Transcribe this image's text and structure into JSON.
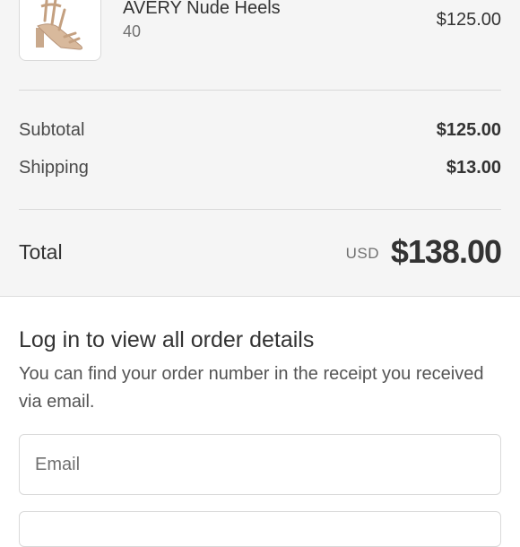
{
  "order_summary": {
    "item": {
      "name": "AVERY Nude Heels",
      "variant": "40",
      "price": "$125.00",
      "image_icon": "heel-sandal-image"
    },
    "subtotal": {
      "label": "Subtotal",
      "value": "$125.00"
    },
    "shipping": {
      "label": "Shipping",
      "value": "$13.00"
    },
    "total": {
      "label": "Total",
      "currency": "USD",
      "value": "$138.00"
    }
  },
  "login": {
    "title": "Log in to view all order details",
    "description": "You can find your order number in the receipt you received via email.",
    "email_placeholder": "Email"
  },
  "colors": {
    "summary_background": "#f5f5f5",
    "text_primary": "#333333",
    "text_muted": "#707070",
    "border": "#d9d9d9"
  }
}
